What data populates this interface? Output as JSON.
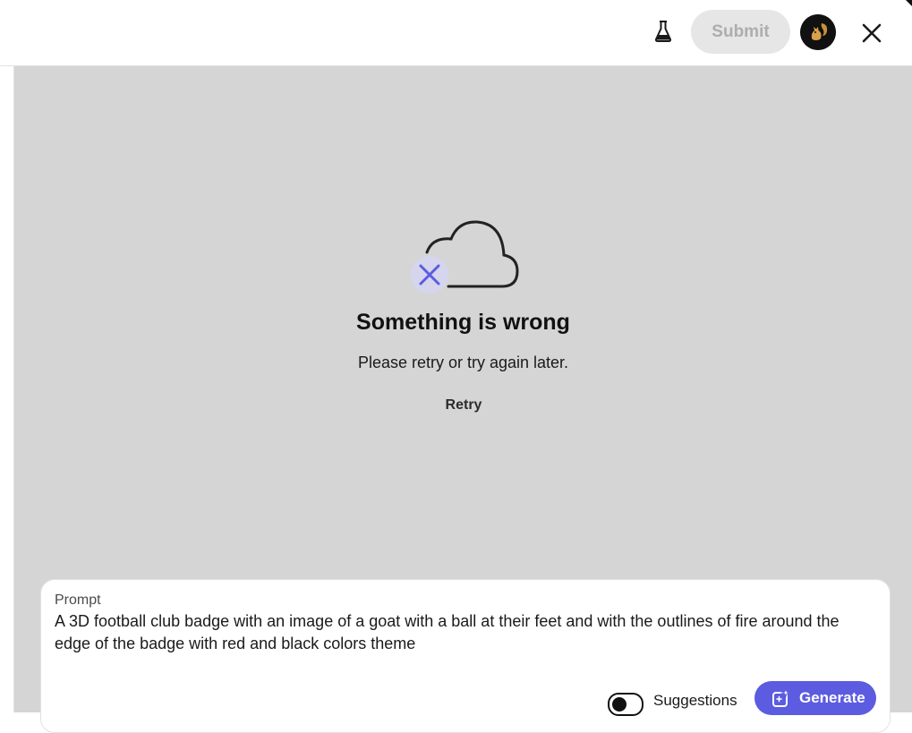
{
  "header": {
    "labs_icon": "flask-icon",
    "submit_label": "Submit",
    "avatar_icon": "squirrel-avatar",
    "close_icon": "close-icon"
  },
  "error": {
    "icon": "cloud-error-icon",
    "title": "Something is wrong",
    "message": "Please retry or try again later.",
    "retry_label": "Retry"
  },
  "prompt": {
    "label": "Prompt",
    "text": "A 3D football club badge with an image of a goat with a ball at their feet and with the outlines of fire around the edge of the badge with red and black colors theme",
    "suggestions_label": "Suggestions",
    "suggestions_enabled": false,
    "generate_label": "Generate",
    "generate_icon": "generate-sparkle-icon"
  },
  "colors": {
    "canvas_bg": "#d5d5d5",
    "accent": "#5c5ce0",
    "error_badge": "#d5d5ee",
    "error_x": "#5c5ce0",
    "submit_disabled_bg": "#e6e6e6",
    "submit_disabled_text": "#adadad"
  }
}
